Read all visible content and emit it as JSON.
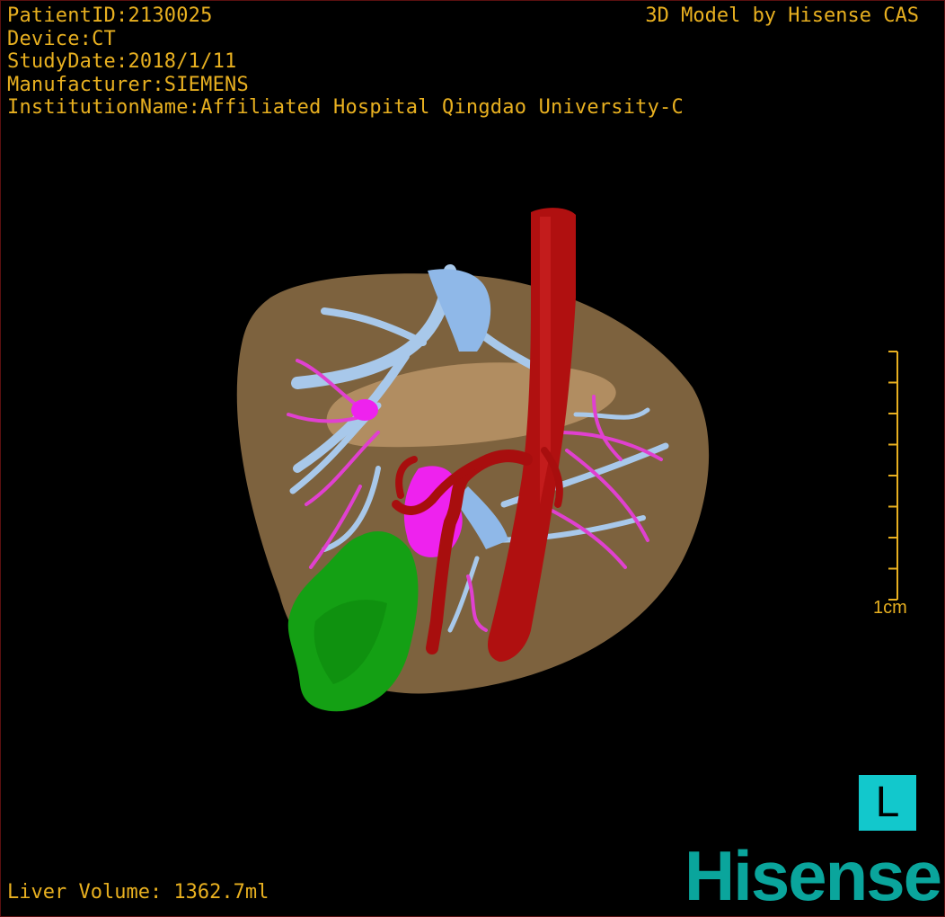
{
  "study_info": {
    "patient_id": "PatientID:2130025",
    "device": "Device:CT",
    "study_date": "StudyDate:2018/1/11",
    "manufacturer": "Manufacturer:SIEMENS",
    "institution": "InstitutionName:Affiliated Hospital Qingdao University-C"
  },
  "credit": "3D Model by Hisense CAS",
  "liver_volume": "Liver Volume: 1362.7ml",
  "scale_bar": {
    "label": "1cm"
  },
  "orientation_marker": "L",
  "brand": "Hisense",
  "colors": {
    "overlay_text": "#e8b020",
    "liver": "#b08a5a",
    "portal_vein": "#a8c8ea",
    "hepatic_vessels": "#e040d0",
    "aorta": "#b01010",
    "tumor": "#12a012",
    "orientation": "#12c8cc",
    "brand": "#0aa59c"
  }
}
